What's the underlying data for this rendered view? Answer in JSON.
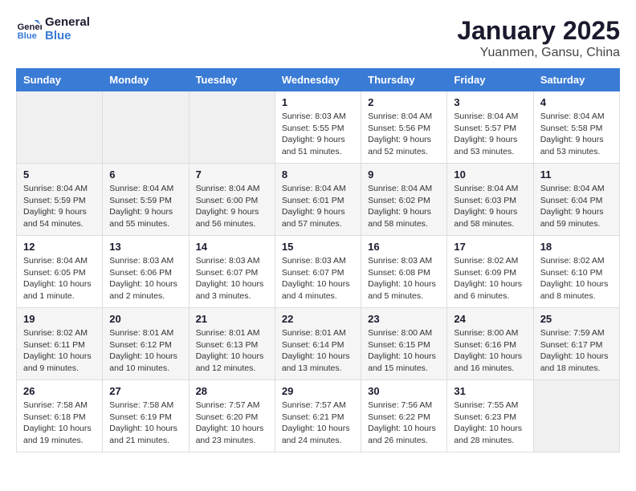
{
  "logo": {
    "line1": "General",
    "line2": "Blue"
  },
  "header": {
    "title": "January 2025",
    "location": "Yuanmen, Gansu, China"
  },
  "weekdays": [
    "Sunday",
    "Monday",
    "Tuesday",
    "Wednesday",
    "Thursday",
    "Friday",
    "Saturday"
  ],
  "weeks": [
    [
      {
        "day": "",
        "sunrise": "",
        "sunset": "",
        "daylight": ""
      },
      {
        "day": "",
        "sunrise": "",
        "sunset": "",
        "daylight": ""
      },
      {
        "day": "",
        "sunrise": "",
        "sunset": "",
        "daylight": ""
      },
      {
        "day": "1",
        "sunrise": "Sunrise: 8:03 AM",
        "sunset": "Sunset: 5:55 PM",
        "daylight": "Daylight: 9 hours and 51 minutes."
      },
      {
        "day": "2",
        "sunrise": "Sunrise: 8:04 AM",
        "sunset": "Sunset: 5:56 PM",
        "daylight": "Daylight: 9 hours and 52 minutes."
      },
      {
        "day": "3",
        "sunrise": "Sunrise: 8:04 AM",
        "sunset": "Sunset: 5:57 PM",
        "daylight": "Daylight: 9 hours and 53 minutes."
      },
      {
        "day": "4",
        "sunrise": "Sunrise: 8:04 AM",
        "sunset": "Sunset: 5:58 PM",
        "daylight": "Daylight: 9 hours and 53 minutes."
      }
    ],
    [
      {
        "day": "5",
        "sunrise": "Sunrise: 8:04 AM",
        "sunset": "Sunset: 5:59 PM",
        "daylight": "Daylight: 9 hours and 54 minutes."
      },
      {
        "day": "6",
        "sunrise": "Sunrise: 8:04 AM",
        "sunset": "Sunset: 5:59 PM",
        "daylight": "Daylight: 9 hours and 55 minutes."
      },
      {
        "day": "7",
        "sunrise": "Sunrise: 8:04 AM",
        "sunset": "Sunset: 6:00 PM",
        "daylight": "Daylight: 9 hours and 56 minutes."
      },
      {
        "day": "8",
        "sunrise": "Sunrise: 8:04 AM",
        "sunset": "Sunset: 6:01 PM",
        "daylight": "Daylight: 9 hours and 57 minutes."
      },
      {
        "day": "9",
        "sunrise": "Sunrise: 8:04 AM",
        "sunset": "Sunset: 6:02 PM",
        "daylight": "Daylight: 9 hours and 58 minutes."
      },
      {
        "day": "10",
        "sunrise": "Sunrise: 8:04 AM",
        "sunset": "Sunset: 6:03 PM",
        "daylight": "Daylight: 9 hours and 58 minutes."
      },
      {
        "day": "11",
        "sunrise": "Sunrise: 8:04 AM",
        "sunset": "Sunset: 6:04 PM",
        "daylight": "Daylight: 9 hours and 59 minutes."
      }
    ],
    [
      {
        "day": "12",
        "sunrise": "Sunrise: 8:04 AM",
        "sunset": "Sunset: 6:05 PM",
        "daylight": "Daylight: 10 hours and 1 minute."
      },
      {
        "day": "13",
        "sunrise": "Sunrise: 8:03 AM",
        "sunset": "Sunset: 6:06 PM",
        "daylight": "Daylight: 10 hours and 2 minutes."
      },
      {
        "day": "14",
        "sunrise": "Sunrise: 8:03 AM",
        "sunset": "Sunset: 6:07 PM",
        "daylight": "Daylight: 10 hours and 3 minutes."
      },
      {
        "day": "15",
        "sunrise": "Sunrise: 8:03 AM",
        "sunset": "Sunset: 6:07 PM",
        "daylight": "Daylight: 10 hours and 4 minutes."
      },
      {
        "day": "16",
        "sunrise": "Sunrise: 8:03 AM",
        "sunset": "Sunset: 6:08 PM",
        "daylight": "Daylight: 10 hours and 5 minutes."
      },
      {
        "day": "17",
        "sunrise": "Sunrise: 8:02 AM",
        "sunset": "Sunset: 6:09 PM",
        "daylight": "Daylight: 10 hours and 6 minutes."
      },
      {
        "day": "18",
        "sunrise": "Sunrise: 8:02 AM",
        "sunset": "Sunset: 6:10 PM",
        "daylight": "Daylight: 10 hours and 8 minutes."
      }
    ],
    [
      {
        "day": "19",
        "sunrise": "Sunrise: 8:02 AM",
        "sunset": "Sunset: 6:11 PM",
        "daylight": "Daylight: 10 hours and 9 minutes."
      },
      {
        "day": "20",
        "sunrise": "Sunrise: 8:01 AM",
        "sunset": "Sunset: 6:12 PM",
        "daylight": "Daylight: 10 hours and 10 minutes."
      },
      {
        "day": "21",
        "sunrise": "Sunrise: 8:01 AM",
        "sunset": "Sunset: 6:13 PM",
        "daylight": "Daylight: 10 hours and 12 minutes."
      },
      {
        "day": "22",
        "sunrise": "Sunrise: 8:01 AM",
        "sunset": "Sunset: 6:14 PM",
        "daylight": "Daylight: 10 hours and 13 minutes."
      },
      {
        "day": "23",
        "sunrise": "Sunrise: 8:00 AM",
        "sunset": "Sunset: 6:15 PM",
        "daylight": "Daylight: 10 hours and 15 minutes."
      },
      {
        "day": "24",
        "sunrise": "Sunrise: 8:00 AM",
        "sunset": "Sunset: 6:16 PM",
        "daylight": "Daylight: 10 hours and 16 minutes."
      },
      {
        "day": "25",
        "sunrise": "Sunrise: 7:59 AM",
        "sunset": "Sunset: 6:17 PM",
        "daylight": "Daylight: 10 hours and 18 minutes."
      }
    ],
    [
      {
        "day": "26",
        "sunrise": "Sunrise: 7:58 AM",
        "sunset": "Sunset: 6:18 PM",
        "daylight": "Daylight: 10 hours and 19 minutes."
      },
      {
        "day": "27",
        "sunrise": "Sunrise: 7:58 AM",
        "sunset": "Sunset: 6:19 PM",
        "daylight": "Daylight: 10 hours and 21 minutes."
      },
      {
        "day": "28",
        "sunrise": "Sunrise: 7:57 AM",
        "sunset": "Sunset: 6:20 PM",
        "daylight": "Daylight: 10 hours and 23 minutes."
      },
      {
        "day": "29",
        "sunrise": "Sunrise: 7:57 AM",
        "sunset": "Sunset: 6:21 PM",
        "daylight": "Daylight: 10 hours and 24 minutes."
      },
      {
        "day": "30",
        "sunrise": "Sunrise: 7:56 AM",
        "sunset": "Sunset: 6:22 PM",
        "daylight": "Daylight: 10 hours and 26 minutes."
      },
      {
        "day": "31",
        "sunrise": "Sunrise: 7:55 AM",
        "sunset": "Sunset: 6:23 PM",
        "daylight": "Daylight: 10 hours and 28 minutes."
      },
      {
        "day": "",
        "sunrise": "",
        "sunset": "",
        "daylight": ""
      }
    ]
  ]
}
